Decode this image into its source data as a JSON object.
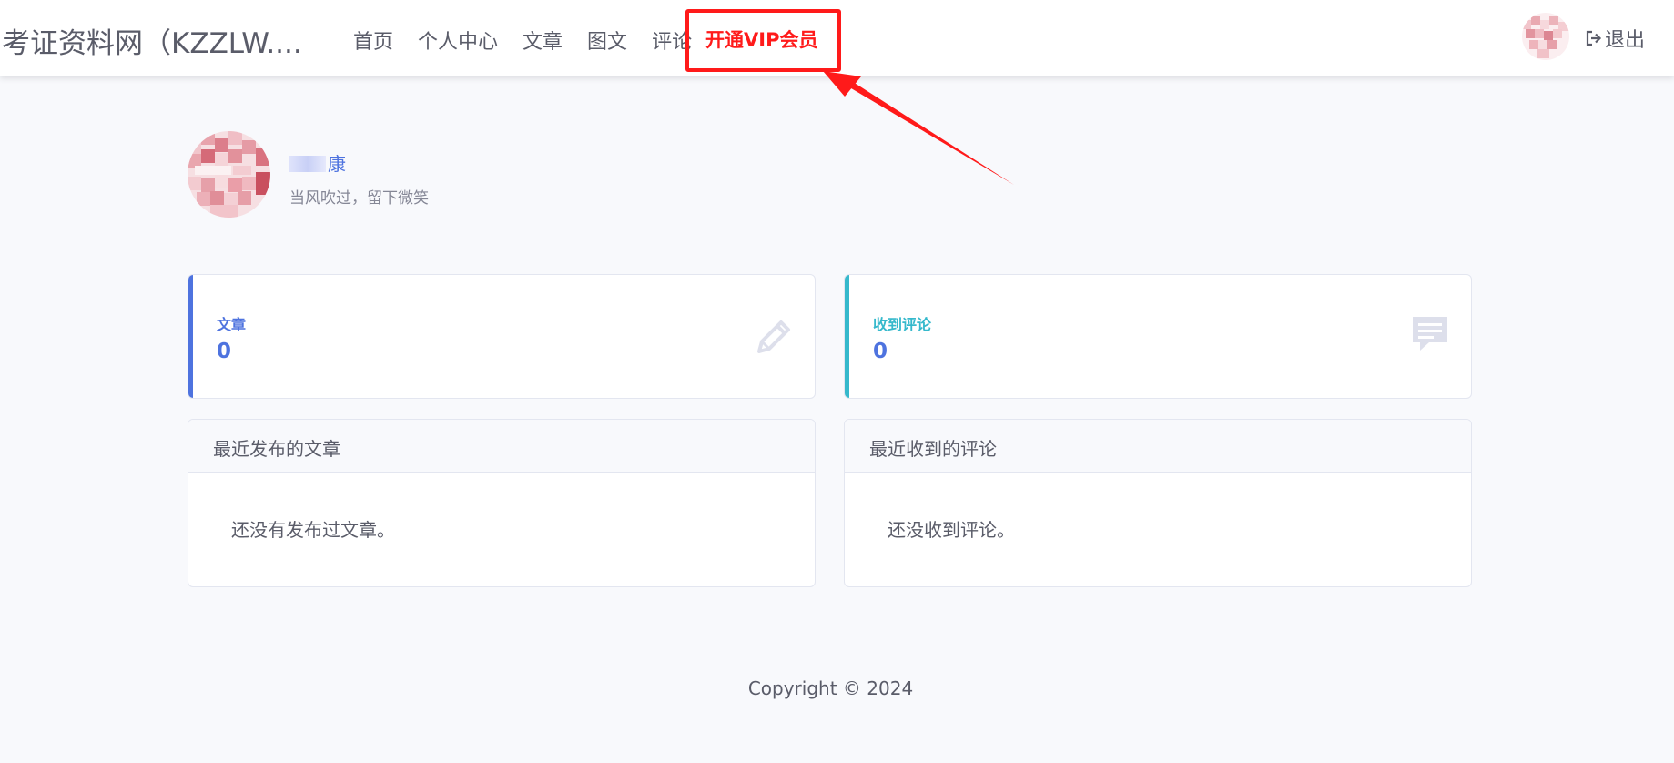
{
  "header": {
    "brand": "考证资料网（KZZLW....",
    "nav": [
      "首页",
      "个人中心",
      "文章",
      "图文",
      "评论"
    ],
    "vip_label": "开通VIP会员",
    "logout_label": "退出",
    "logout_icon": "sign-out-icon"
  },
  "profile": {
    "name": "康",
    "motto": "当风吹过，留下微笑"
  },
  "stats": [
    {
      "label": "文章",
      "value": "0",
      "accent": "#4e73df",
      "label_color": "#4e73df",
      "icon": "pencil-icon"
    },
    {
      "label": "收到评论",
      "value": "0",
      "accent": "#36b9cc",
      "label_color": "#36b9cc",
      "icon": "comment-icon"
    }
  ],
  "panels": [
    {
      "title": "最近发布的文章",
      "empty_text": "还没有发布过文章。"
    },
    {
      "title": "最近收到的评论",
      "empty_text": "还没收到评论。"
    }
  ],
  "footer": {
    "text": "Copyright © 2024"
  },
  "colors": {
    "highlight": "#ff1a1a",
    "primary": "#4e73df",
    "info": "#36b9cc"
  }
}
